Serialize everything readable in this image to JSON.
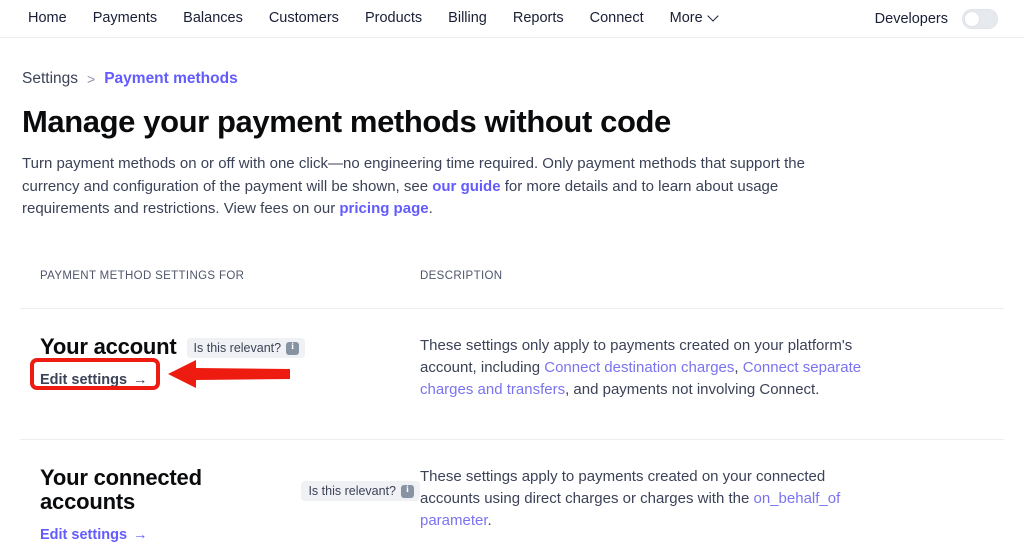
{
  "nav": {
    "items": [
      {
        "label": "Home",
        "icon": null
      },
      {
        "label": "Payments",
        "icon": null
      },
      {
        "label": "Balances",
        "icon": null
      },
      {
        "label": "Customers",
        "icon": null
      },
      {
        "label": "Products",
        "icon": null
      },
      {
        "label": "Billing",
        "icon": null
      },
      {
        "label": "Reports",
        "icon": null
      },
      {
        "label": "Connect",
        "icon": null
      },
      {
        "label": "More",
        "icon": "chevron-down-icon"
      }
    ],
    "developers_label": "Developers",
    "developers_toggle_state": "off"
  },
  "breadcrumb": {
    "root": "Settings",
    "separator": ">",
    "current": "Payment methods"
  },
  "page": {
    "title": "Manage your payment methods without code",
    "description": {
      "part1": "Turn payment methods on or off with one click—no engineering time required. Only payment methods that support the currency and configuration of the payment will be shown, see ",
      "link1": "our guide",
      "part2": " for more details and to learn about usage requirements and restrictions. View fees on our ",
      "link2": "pricing page",
      "part3": "."
    }
  },
  "table": {
    "headers": {
      "col1": "PAYMENT METHOD SETTINGS FOR",
      "col2": "DESCRIPTION"
    },
    "rows": [
      {
        "name": "Your account",
        "badge_label": "Is this relevant?",
        "badge_icon": "info-icon",
        "edit_label": "Edit settings",
        "edit_arrow": "→",
        "description": {
          "part1": "These settings only apply to payments created on your platform's account, including ",
          "link1": "Connect destination charges",
          "part2": ", ",
          "link2": "Connect separate charges and transfers",
          "part3": ", and payments not involving Connect."
        }
      },
      {
        "name": "Your connected accounts",
        "badge_label": "Is this relevant?",
        "badge_icon": "info-icon",
        "edit_label": "Edit settings",
        "edit_arrow": "→",
        "description": {
          "part1": "These settings apply to payments created on your connected accounts using direct charges or charges with the ",
          "link1": "on_behalf_of parameter",
          "part2": "."
        }
      }
    ]
  },
  "annotation": {
    "color": "#ee1b11",
    "shape": "arrow-pointing-left-at-edit-settings",
    "highlight_target": "Edit settings"
  },
  "colors": {
    "brand_purple": "#635bff",
    "link_purple_light": "#7a73f0",
    "text_primary": "#0a0b0d",
    "text_secondary": "#3c4257",
    "divider": "#eceef1",
    "annotation_red": "#ee1b11"
  }
}
